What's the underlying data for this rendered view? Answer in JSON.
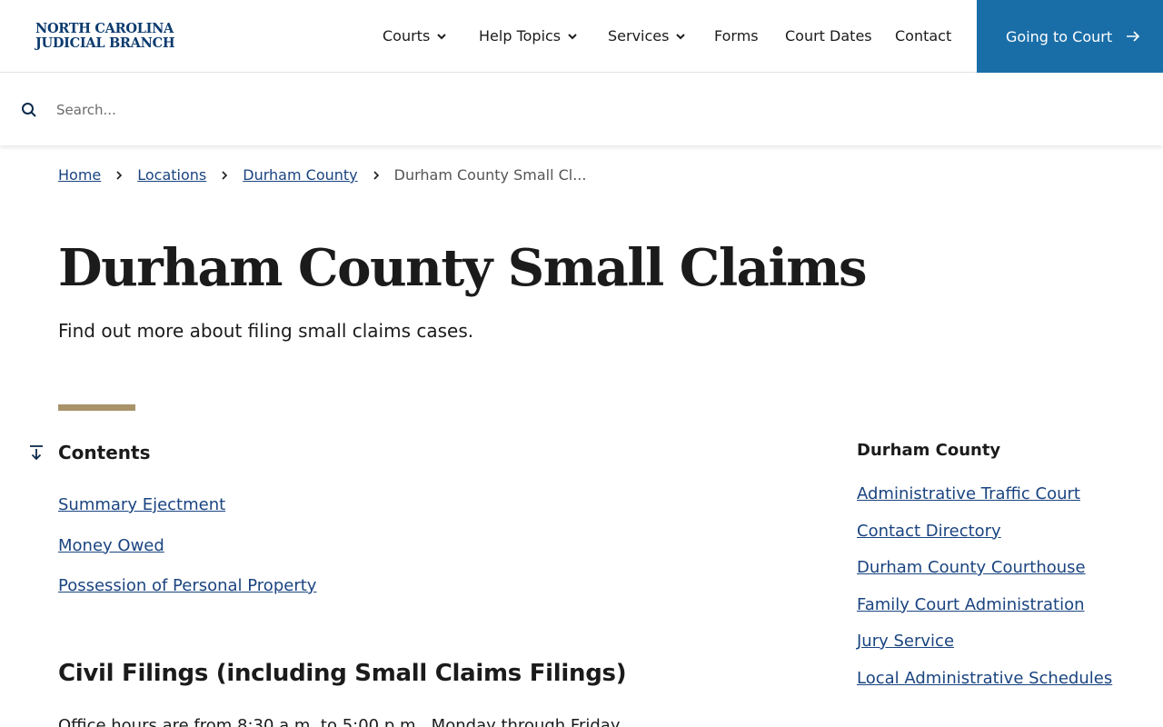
{
  "header": {
    "logo_line1": "NORTH CAROLINA",
    "logo_line2": "JUDICIAL BRANCH",
    "nav": [
      {
        "label": "Courts",
        "has_dropdown": true
      },
      {
        "label": "Help Topics",
        "has_dropdown": true
      },
      {
        "label": "Services",
        "has_dropdown": true
      },
      {
        "label": "Forms",
        "has_dropdown": false
      },
      {
        "label": "Court Dates",
        "has_dropdown": false
      },
      {
        "label": "Contact",
        "has_dropdown": false
      }
    ],
    "cta_label": "Going to Court",
    "cta_color": "#1a6ea8"
  },
  "search": {
    "placeholder": "Search...",
    "value": ""
  },
  "breadcrumb": {
    "items": [
      "Home",
      "Locations",
      "Durham County"
    ],
    "current": "Durham County Small Cl..."
  },
  "page": {
    "title": "Durham County Small Claims",
    "subtitle": "Find out more about filing small claims cases.",
    "accent_color": "#a8936a"
  },
  "contents": {
    "title": "Contents",
    "items": [
      "Summary Ejectment",
      "Money Owed",
      "Possession of Personal Property"
    ]
  },
  "section": {
    "title": "Civil Filings (including Small Claims Filings)",
    "body": "Office hours are from 8:30 a.m. to 5:00 p.m., Monday through Friday."
  },
  "sidebar": {
    "title": "Durham County",
    "items": [
      "Administrative Traffic Court",
      "Contact Directory",
      "Durham County Courthouse",
      "Family Court Administration",
      "Jury Service",
      "Local Administrative Schedules"
    ]
  },
  "colors": {
    "link": "#1a4480",
    "logo": "#0b3b6e"
  }
}
